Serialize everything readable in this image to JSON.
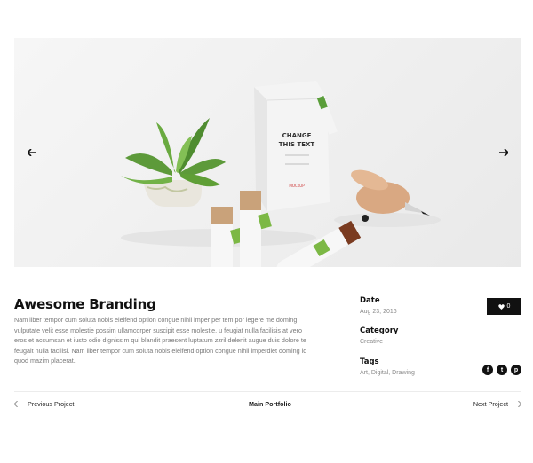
{
  "slider": {
    "prev_icon": "arrow-left-icon",
    "next_icon": "arrow-right-icon",
    "mockup": {
      "bag_text_line1": "CHANGE",
      "bag_text_line2": "THIS TEXT",
      "bag_small_label": "MOCKUP"
    }
  },
  "project": {
    "title": "Awesome Branding",
    "description": "Nam liber tempor cum soluta nobis eleifend option congue nihil imper per tem por legere me doming vulputate velit esse molestie possim ullamcorper suscipit esse molestie. u feugiat nulla facilisis at vero eros et accumsan et iusto odio dignissim qui blandit praesent luptatum zzril delenit augue duis dolore te feugait nulla facilisi. Nam liber tempor cum soluta nobis eleifend option congue nihil imperdiet doming id quod mazim placerat."
  },
  "meta": {
    "date_label": "Date",
    "date_value": "Aug 23, 2016",
    "category_label": "Category",
    "category_value": "Creative",
    "tags_label": "Tags",
    "tags_value": "Art, Digital, Drawing"
  },
  "like": {
    "icon": "heart-icon",
    "count": "0"
  },
  "social": [
    {
      "name": "facebook-icon",
      "glyph": "f"
    },
    {
      "name": "twitter-icon",
      "glyph": "t"
    },
    {
      "name": "pinterest-icon",
      "glyph": "p"
    }
  ],
  "navigation": {
    "previous_label": "Previous Project",
    "main_label": "Main Portfolio",
    "next_label": "Next Project"
  }
}
